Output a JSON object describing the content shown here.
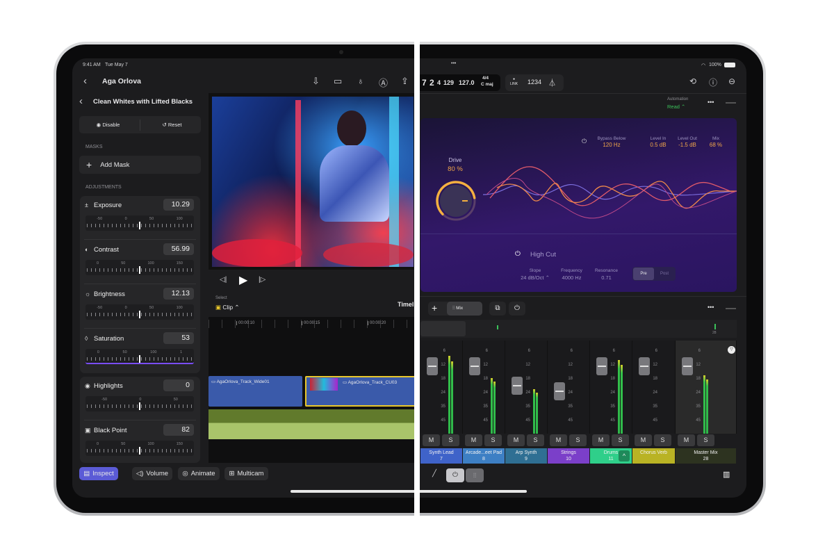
{
  "status_bar": {
    "time": "9:41 AM",
    "date": "Tue May 7",
    "dots": "•••",
    "wifi_icon": "wifi-icon",
    "battery": "100%"
  },
  "fcp": {
    "header": {
      "title": "Aga Orlova",
      "icons": [
        "import-icon",
        "camera-icon",
        "microphone-icon",
        "navigator-icon",
        "share-icon"
      ]
    },
    "inspector": {
      "title": "Clean Whites with Lifted Blacks",
      "disable_label": "Disable",
      "reset_label": "Reset",
      "masks_heading": "MASKS",
      "add_mask_label": "Add Mask",
      "adjustments_heading": "ADJUSTMENTS",
      "adjustments": [
        {
          "label": "Exposure",
          "value": "10.29",
          "scale": [
            "-50",
            "0",
            "50",
            "100"
          ],
          "symbol": "±"
        },
        {
          "label": "Contrast",
          "value": "56.99",
          "scale": [
            "0",
            "50",
            "100",
            "150"
          ],
          "symbol": "◐"
        },
        {
          "label": "Brightness",
          "value": "12.13",
          "scale": [
            "-50",
            "0",
            "50",
            "100"
          ],
          "symbol": "☼"
        },
        {
          "label": "Saturation",
          "value": "53",
          "scale": [
            "0",
            "50",
            "100",
            "1"
          ],
          "symbol": "◊"
        },
        {
          "label": "Highlights",
          "value": "0",
          "scale": [
            "-50",
            "0",
            "50"
          ],
          "symbol": "◉"
        },
        {
          "label": "Black Point",
          "value": "82",
          "scale": [
            "0",
            "50",
            "100",
            "150"
          ],
          "symbol": "▣"
        }
      ]
    },
    "timeline": {
      "select_label": "Select",
      "select_value": "Clip",
      "title": "Timel",
      "ruler": [
        "00:00:10",
        "00:00:15",
        "00:00:20"
      ],
      "clips": [
        "AgaOrlova_Track_Wide01",
        "AgaOrlova_Track_CU03"
      ]
    },
    "bottom_bar": {
      "inspect": "Inspect",
      "volume": "Volume",
      "animate": "Animate",
      "multicam": "Multicam"
    }
  },
  "logic": {
    "lcd": {
      "bar": "7",
      "beat": "2",
      "div": "4",
      "tick": "129",
      "tempo": "127.0",
      "signature": "4/4",
      "key": "C maj"
    },
    "link_label": "LINK",
    "count_in": "1234",
    "automation_label": "Automation",
    "automation_value": "Read",
    "plugin": {
      "drive_label": "Drive",
      "drive_value": "80 %",
      "drive_level": 0.8,
      "bypass_label": "Bypass Below",
      "bypass_value": "120 Hz",
      "level_in_label": "Level In",
      "level_in_value": "0.5 dB",
      "level_out_label": "Level Out",
      "level_out_value": "-1.5 dB",
      "mix_label": "Mix",
      "mix_value": "68 %",
      "high_cut_label": "High Cut",
      "slope_label": "Slope",
      "slope_value": "24 dB/Oct",
      "frequency_label": "Frequency",
      "frequency_value": "4000 Hz",
      "resonance_label": "Resonance",
      "resonance_value": "0.71",
      "pre_label": "Pre",
      "post_label": "Post"
    },
    "mixer": {
      "mix_label": "Mix",
      "overview_number": "28",
      "scale": [
        "6",
        "12",
        "18",
        "24",
        "35",
        "45"
      ],
      "mute_label": "M",
      "solo_label": "S",
      "channels": [
        {
          "name": "Synth Lead",
          "number": "7",
          "color": "#3f63c9",
          "fader": 0.8,
          "meter": 0.93
        },
        {
          "name": "Arcade...eet Pad",
          "number": "8",
          "color": "#3d7fc4",
          "fader": 0.8,
          "meter": 0.67
        },
        {
          "name": "Arp Synth",
          "number": "9",
          "color": "#2f6f93",
          "fader": 0.45,
          "meter": 0.53
        },
        {
          "name": "Strings",
          "number": "10",
          "color": "#7b3fc9",
          "fader": 0.35,
          "meter": 0
        },
        {
          "name": "Drums",
          "number": "11",
          "color": "#2fcf8a",
          "fader": 0.8,
          "meter": 0.88
        },
        {
          "name": "Chorus Verb",
          "number": "",
          "color": "#b9b324",
          "fader": 0.8,
          "meter": 0
        },
        {
          "name": "Master Mix",
          "number": "28",
          "color": "#2d3320",
          "fader": 0.8,
          "meter": 0.7
        }
      ]
    }
  }
}
